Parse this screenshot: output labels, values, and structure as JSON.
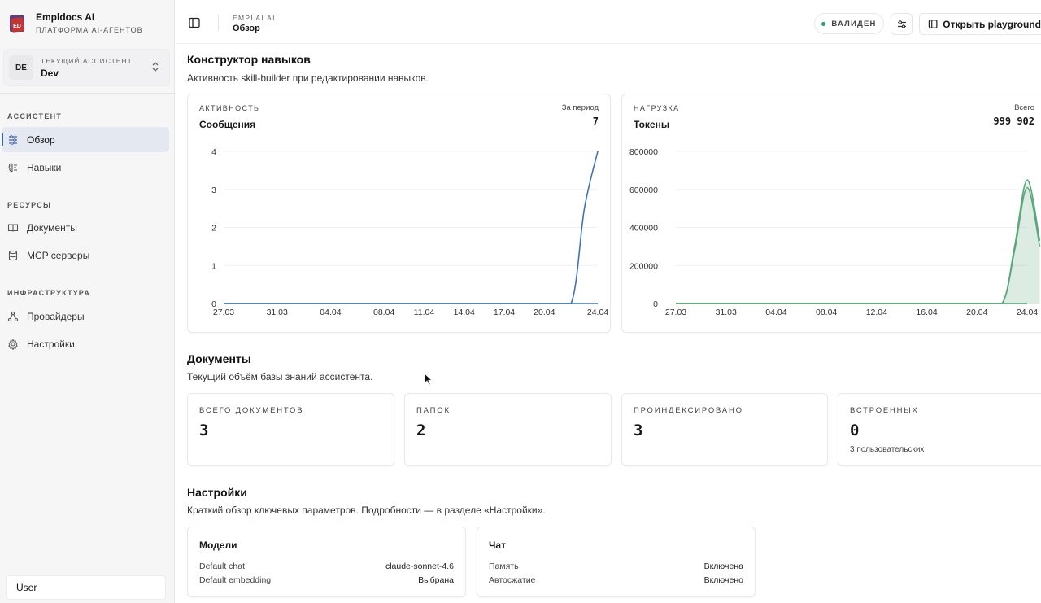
{
  "brand": {
    "title": "Empldocs AI",
    "subtitle": "ПЛАТФОРМА AI-АГЕНТОВ",
    "logo_text": "ED"
  },
  "assistant": {
    "label": "ТЕКУЩИЙ АССИСТЕНТ",
    "name": "Dev",
    "initials": "DE"
  },
  "sidebar": {
    "sections": [
      {
        "title": "АССИСТЕНТ",
        "items": [
          {
            "label": "Обзор",
            "icon": "sliders-icon",
            "active": true
          },
          {
            "label": "Навыки",
            "icon": "brain-icon"
          }
        ]
      },
      {
        "title": "РЕСУРСЫ",
        "items": [
          {
            "label": "Документы",
            "icon": "book-icon"
          },
          {
            "label": "MCP серверы",
            "icon": "database-icon"
          }
        ]
      },
      {
        "title": "ИНФРАСТРУКТУРА",
        "items": [
          {
            "label": "Провайдеры",
            "icon": "network-icon"
          },
          {
            "label": "Настройки",
            "icon": "gear-icon"
          }
        ]
      }
    ],
    "user": "User"
  },
  "header": {
    "crumb": "EMPLAI AI",
    "title": "Обзор",
    "badge": "ВАЛИДЕН",
    "playground_label": "Открыть playground"
  },
  "skills": {
    "title": "Конструктор навыков",
    "subtitle": "Активность skill-builder при редактировании навыков.",
    "activity": {
      "caption": "АКТИВНОСТЬ",
      "name": "Сообщения",
      "period_label": "За период",
      "period_value": "7"
    },
    "load": {
      "caption": "НАГРУЗКА",
      "name": "Токены",
      "period_label": "Всего",
      "period_value": "999 902"
    }
  },
  "documents": {
    "title": "Документы",
    "subtitle": "Текущий объём базы знаний ассистента.",
    "stats": [
      {
        "caption": "ВСЕГО ДОКУМЕНТОВ",
        "value": "3",
        "note": ""
      },
      {
        "caption": "ПАПОК",
        "value": "2",
        "note": ""
      },
      {
        "caption": "ПРОИНДЕКСИРОВАНО",
        "value": "3",
        "note": ""
      },
      {
        "caption": "ВСТРОЕННЫХ",
        "value": "0",
        "note": "3 пользовательских"
      }
    ]
  },
  "settings": {
    "title": "Настройки",
    "subtitle": "Краткий обзор ключевых параметров. Подробности — в разделе «Настройки».",
    "models": {
      "title": "Модели",
      "rows": [
        {
          "label": "Default chat",
          "value": "claude-sonnet-4.6"
        },
        {
          "label": "Default embedding",
          "value": "Выбрана"
        }
      ]
    },
    "chat": {
      "title": "Чат",
      "rows": [
        {
          "label": "Память",
          "value": "Включена"
        },
        {
          "label": "Автосжатие",
          "value": "Включено"
        }
      ]
    }
  },
  "colors": {
    "accent": "#3a64b0",
    "line_blue": "#3f74b3",
    "line_green": "#5aa77a",
    "valid": "#22a06b"
  },
  "chart_data": [
    {
      "type": "line",
      "xlabel": "",
      "ylabel": "",
      "x_ticks": [
        "27.03",
        "31.03",
        "04.04",
        "08.04",
        "11.04",
        "14.04",
        "17.04",
        "20.04",
        "24.04"
      ],
      "y_ticks": [
        "0",
        "1",
        "2",
        "3",
        "4"
      ],
      "ylim": [
        0,
        4
      ],
      "series": [
        {
          "values": [
            [
              "27.03",
              0
            ],
            [
              "31.03",
              0
            ],
            [
              "04.04",
              0
            ],
            [
              "08.04",
              0
            ],
            [
              "11.04",
              0
            ],
            [
              "14.04",
              0
            ],
            [
              "17.04",
              0
            ],
            [
              "20.04",
              0
            ],
            [
              "22.04",
              0
            ],
            [
              "23.04",
              2.5
            ],
            [
              "24.04",
              4
            ]
          ]
        }
      ],
      "grid": true
    },
    {
      "type": "area",
      "xlabel": "",
      "ylabel": "",
      "x_ticks": [
        "27.03",
        "31.03",
        "04.04",
        "08.04",
        "12.04",
        "16.04",
        "20.04",
        "24.04"
      ],
      "y_ticks": [
        "0",
        "200000",
        "400000",
        "600000",
        "800000"
      ],
      "ylim": [
        0,
        800000
      ],
      "series": [
        {
          "values": [
            [
              "27.03",
              0
            ],
            [
              "31.03",
              0
            ],
            [
              "04.04",
              0
            ],
            [
              "08.04",
              0
            ],
            [
              "12.04",
              0
            ],
            [
              "16.04",
              0
            ],
            [
              "20.04",
              0
            ],
            [
              "22.04",
              0
            ],
            [
              "23.04",
              300000
            ],
            [
              "24.04",
              650000
            ],
            [
              "25.04",
              330000
            ]
          ]
        },
        {
          "values": [
            [
              "27.03",
              0
            ],
            [
              "31.03",
              0
            ],
            [
              "04.04",
              0
            ],
            [
              "08.04",
              0
            ],
            [
              "12.04",
              0
            ],
            [
              "16.04",
              0
            ],
            [
              "20.04",
              0
            ],
            [
              "22.04",
              0
            ],
            [
              "23.04",
              280000
            ],
            [
              "24.04",
              610000
            ],
            [
              "25.04",
              300000
            ]
          ]
        }
      ],
      "grid": true
    }
  ]
}
